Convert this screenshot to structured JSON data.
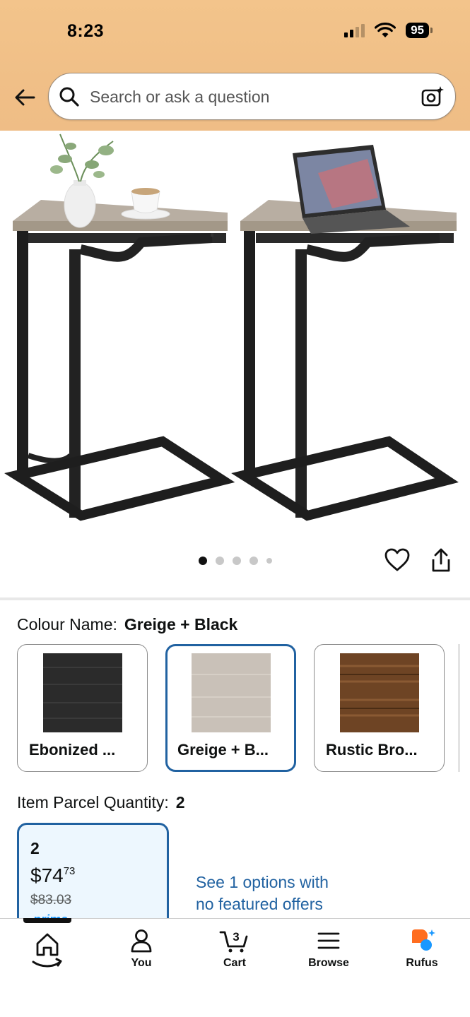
{
  "status_bar": {
    "time": "8:23",
    "battery": "95"
  },
  "search": {
    "placeholder": "Search or ask a question"
  },
  "carousel": {
    "image_count": 5,
    "active_index": 0
  },
  "colour": {
    "label": "Colour Name:",
    "selected": "Greige + Black",
    "options": [
      {
        "label": "Ebonized ...",
        "swatch_color": "#2b2b2b"
      },
      {
        "label": "Greige + B...",
        "swatch_color": "#c9c1b8"
      },
      {
        "label": "Rustic Bro...",
        "swatch_color": "#6e4424"
      }
    ]
  },
  "quantity": {
    "label": "Item Parcel Quantity:",
    "selected": "2",
    "card": {
      "qty": "2",
      "price_dollars": "$74",
      "price_cents": "73",
      "list_price": "$83.03",
      "badge": "prime"
    }
  },
  "options_link": {
    "line1": "See 1 options with",
    "line2": "no featured offers"
  },
  "nav": {
    "you": "You",
    "cart": "Cart",
    "cart_count": "3",
    "browse": "Browse",
    "rufus": "Rufus"
  },
  "colors": {
    "header": "#f0bf87",
    "link": "#2162a1",
    "selected_border": "#2162a1",
    "rufus_orange": "#ff6d1f",
    "rufus_blue": "#1a98ff"
  }
}
